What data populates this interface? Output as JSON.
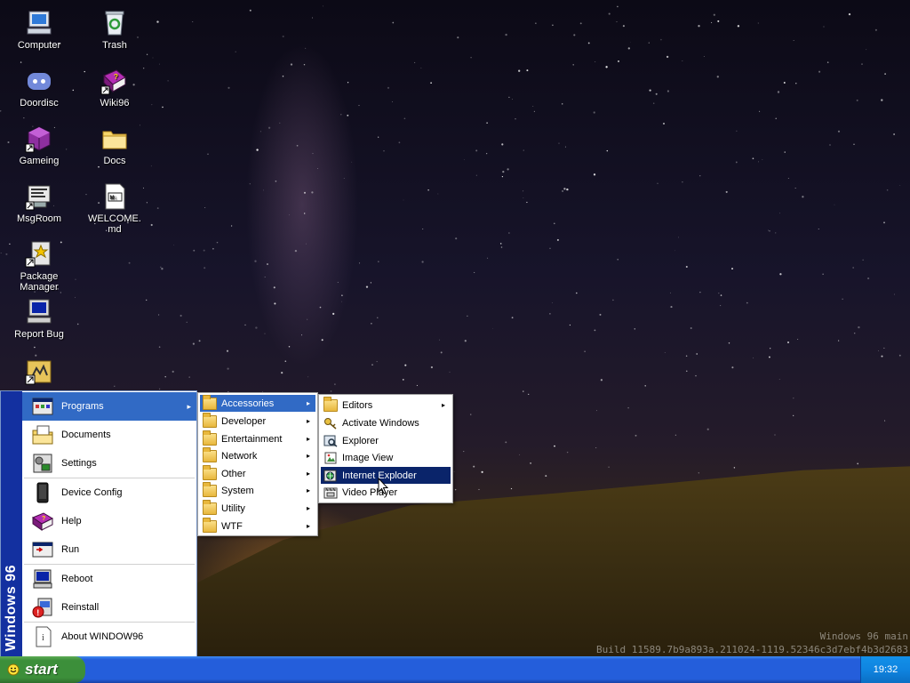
{
  "desktop": {
    "icons": [
      {
        "label": "Computer",
        "icon": "computer-icon"
      },
      {
        "label": "Trash",
        "icon": "recycle-bin-icon"
      },
      {
        "label": "Doordisc",
        "icon": "discord-icon"
      },
      {
        "label": "Wiki96",
        "icon": "help-book-icon"
      },
      {
        "label": "Gameing",
        "icon": "game-cube-icon"
      },
      {
        "label": "Docs",
        "icon": "folder-icon"
      },
      {
        "label": "MsgRoom",
        "icon": "chat-icon"
      },
      {
        "label": "WELCOME.md",
        "icon": "markdown-file-icon"
      },
      {
        "label": "Package Manager",
        "icon": "package-icon"
      },
      {
        "label": "Report Bug",
        "icon": "monitor-icon"
      },
      {
        "label": "",
        "icon": "app-shortcut-icon"
      }
    ]
  },
  "start_menu": {
    "banner": "Windows 96",
    "items": [
      {
        "label": "Programs",
        "icon": "programs-icon",
        "has_submenu": true,
        "highlighted": true
      },
      {
        "label": "Documents",
        "icon": "documents-icon"
      },
      {
        "label": "Settings",
        "icon": "settings-icon"
      },
      {
        "label": "Device Config",
        "icon": "device-icon"
      },
      {
        "label": "Help",
        "icon": "help-icon"
      },
      {
        "label": "Run",
        "icon": "run-icon"
      },
      {
        "label": "Reboot",
        "icon": "reboot-icon"
      },
      {
        "label": "Reinstall",
        "icon": "reinstall-icon"
      },
      {
        "label": "About WINDOW96",
        "icon": "info-icon"
      }
    ]
  },
  "programs_menu": {
    "items": [
      {
        "label": "Accessories",
        "highlighted": true
      },
      {
        "label": "Developer"
      },
      {
        "label": "Entertainment"
      },
      {
        "label": "Network"
      },
      {
        "label": "Other"
      },
      {
        "label": "System"
      },
      {
        "label": "Utility"
      },
      {
        "label": "WTF"
      }
    ]
  },
  "accessories_menu": {
    "items": [
      {
        "label": "Editors",
        "icon": "folder-icon",
        "has_submenu": true
      },
      {
        "label": "Activate Windows",
        "icon": "key-icon"
      },
      {
        "label": "Explorer",
        "icon": "explorer-icon"
      },
      {
        "label": "Image View",
        "icon": "image-icon"
      },
      {
        "label": "Internet Exploder",
        "icon": "internet-icon",
        "highlighted": true
      },
      {
        "label": "Video Player",
        "icon": "video-icon"
      }
    ]
  },
  "taskbar": {
    "start_label": "start",
    "clock": "19:32"
  },
  "watermark": {
    "line1": "Windows 96 main",
    "line2": "Build 11589.7b9a893a.211024-1119.52346c3d7ebf4b3d2683"
  },
  "colors": {
    "highlight": "#316ac5",
    "highlight_dark": "#0a246a",
    "banner": "#1330a0",
    "taskbar": "#245edb",
    "start_button": "#3c8f3a"
  }
}
